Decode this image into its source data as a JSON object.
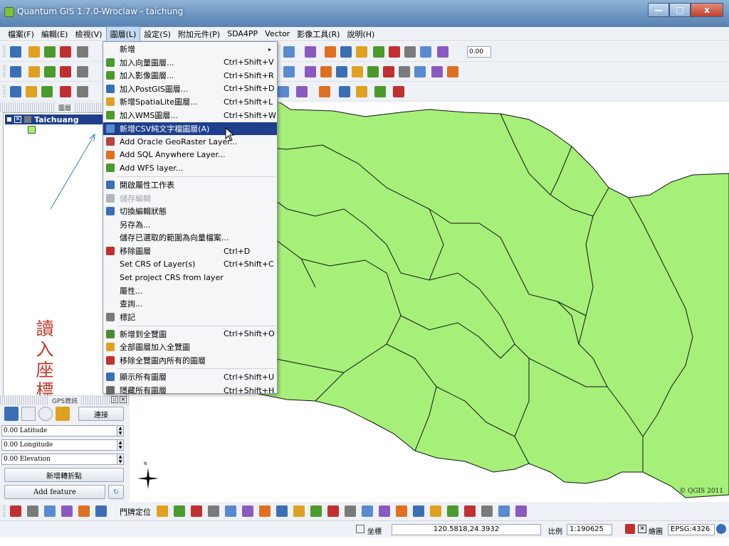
{
  "window": {
    "title": "Quantum GIS 1.7.0-Wroclaw - taichung",
    "minimize": "—",
    "maximize": "□",
    "close": "x"
  },
  "menubar": [
    "檔案(F)",
    "編輯(E)",
    "檢視(V)",
    "圖層(L)",
    "設定(S)",
    "附加元件(P)",
    "SDA4PP",
    "Vector",
    "影像工具(R)",
    "說明(H)"
  ],
  "menubar_active_index": 3,
  "toolbar": {
    "zoom_value": "0.00"
  },
  "dropdown": [
    {
      "label": "新增",
      "shortcut": "",
      "submenu": true,
      "icon": "none"
    },
    {
      "label": "加入向量圖層...",
      "shortcut": "Ctrl+Shift+V",
      "icon": "add-vector-layer-icon",
      "color": "#4a9a2c"
    },
    {
      "label": "加入影像圖層...",
      "shortcut": "Ctrl+Shift+R",
      "icon": "add-raster-layer-icon",
      "color": "#4a9a2c"
    },
    {
      "label": "加入PostGIS圖層...",
      "shortcut": "Ctrl+Shift+D",
      "icon": "add-postgis-layer-icon",
      "color": "#3a6fb5"
    },
    {
      "label": "新增SpatiaLite圖層...",
      "shortcut": "Ctrl+Shift+L",
      "icon": "add-spatialite-layer-icon",
      "color": "#e0a020"
    },
    {
      "label": "加入WMS圖層...",
      "shortcut": "Ctrl+Shift+W",
      "icon": "add-wms-layer-icon",
      "color": "#4a9a2c"
    },
    {
      "label": "新增CSV純文字檔圖層(A)",
      "shortcut": "",
      "icon": "add-csv-layer-icon",
      "color": "#5a8ad0",
      "highlight": true
    },
    {
      "label": "Add Oracle GeoRaster Layer...",
      "shortcut": "",
      "icon": "oracle-georaster-icon",
      "color": "#c04040"
    },
    {
      "label": "Add SQL Anywhere Layer...",
      "shortcut": "",
      "icon": "sql-anywhere-icon",
      "color": "#e07020"
    },
    {
      "label": "Add WFS layer...",
      "shortcut": "",
      "icon": "wfs-layer-icon",
      "color": "#4a9a2c"
    },
    {
      "separator": true
    },
    {
      "label": "開啟屬性工作表",
      "shortcut": "",
      "icon": "attribute-table-icon",
      "color": "#3a6fb5"
    },
    {
      "label": "儲存編輯",
      "shortcut": "",
      "icon": "save-edits-icon",
      "color": "#b0b6be",
      "disabled": true
    },
    {
      "label": "切換編輯狀態",
      "shortcut": "",
      "icon": "toggle-editing-icon",
      "color": "#3a6fb5"
    },
    {
      "label": "另存為...",
      "shortcut": "",
      "icon": "none"
    },
    {
      "label": "儲存已選取的範圍為向量檔案...",
      "shortcut": "",
      "icon": "none"
    },
    {
      "label": "移除圖層",
      "shortcut": "Ctrl+D",
      "icon": "remove-layer-icon",
      "color": "#c03030"
    },
    {
      "label": "Set CRS of Layer(s)",
      "shortcut": "Ctrl+Shift+C",
      "icon": "none"
    },
    {
      "label": "Set project CRS from layer",
      "shortcut": "",
      "icon": "none"
    },
    {
      "label": "屬性...",
      "shortcut": "",
      "icon": "none"
    },
    {
      "label": "查詢...",
      "shortcut": "",
      "icon": "none"
    },
    {
      "label": "標記",
      "shortcut": "",
      "icon": "label-icon",
      "color": "#7a7a7a"
    },
    {
      "separator": true
    },
    {
      "label": "新增到全覽圖",
      "shortcut": "Ctrl+Shift+O",
      "icon": "add-to-overview-icon",
      "color": "#4a8a30"
    },
    {
      "label": "全部圖層加入全覽圖",
      "shortcut": "",
      "icon": "add-all-to-overview-icon",
      "color": "#e0a020"
    },
    {
      "label": "移除全覽圖內所有的圖層",
      "shortcut": "",
      "icon": "remove-all-from-overview-icon",
      "color": "#c03030"
    },
    {
      "separator": true
    },
    {
      "label": "顯示所有圖層",
      "shortcut": "Ctrl+Shift+U",
      "icon": "show-all-layers-icon",
      "color": "#3a6fb5"
    },
    {
      "label": "隱藏所有圖層",
      "shortcut": "Ctrl+Shift+H",
      "icon": "hide-all-layers-icon",
      "color": "#6a6a6a"
    }
  ],
  "layers_panel": {
    "title": "圖層",
    "layer_name": "Taichuang",
    "swatch_color": "#a6f07a"
  },
  "annotation": {
    "text": "讀入座標資料檔",
    "color": "#c0392b"
  },
  "gps_panel": {
    "title": "GPS資訊",
    "connect": "連接",
    "latitude": "0.00 Latitude",
    "longitude": "0.00 Longitude",
    "elevation": "0.00 Elevation",
    "add_vertex": "新增轉折點",
    "add_feature": "Add feature"
  },
  "map": {
    "fill_color": "#a6f07a",
    "copyright": "© QGIS 2011",
    "north_label": "N"
  },
  "bottom_toolbar": {
    "geocode_label": "門牌定位"
  },
  "statusbar": {
    "coord_label": "坐標",
    "coordinate": "120.5818,24.3932",
    "scale_label": "比例",
    "scale": "1:190625",
    "render_label": "繪圖",
    "crs": "EPSG:4326"
  }
}
